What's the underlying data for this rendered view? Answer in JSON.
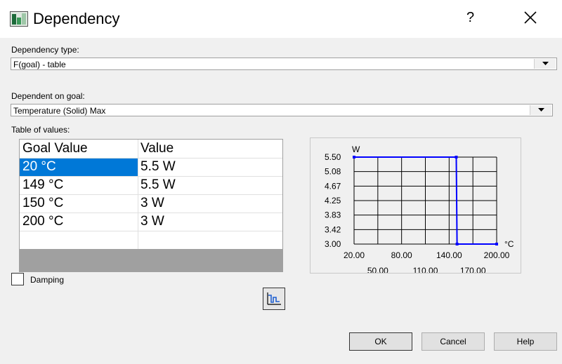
{
  "window": {
    "title": "Dependency",
    "help_label": "?"
  },
  "dependency_type": {
    "label": "Dependency type:",
    "value": "F(goal) - table"
  },
  "dependent_on": {
    "label": "Dependent on goal:",
    "value": "Temperature (Solid) Max"
  },
  "table": {
    "label": "Table of values:",
    "headers": [
      "Goal Value",
      "Value"
    ],
    "rows": [
      [
        "20 °C",
        "5.5 W"
      ],
      [
        "149 °C",
        "5.5 W"
      ],
      [
        "150 °C",
        "3 W"
      ],
      [
        "200 °C",
        "3 W"
      ]
    ],
    "selected_row": 0
  },
  "chart_data": {
    "type": "line",
    "series": [
      {
        "x": [
          20,
          149,
          150,
          200
        ],
        "y": [
          5.5,
          5.5,
          3,
          3
        ]
      }
    ],
    "x_ticks_row1": [
      "20.00",
      "80.00",
      "140.00",
      "200.00"
    ],
    "x_ticks_row2": [
      "50.00",
      "110.00",
      "170.00"
    ],
    "y_ticks": [
      "5.50",
      "5.08",
      "4.67",
      "4.25",
      "3.83",
      "3.42",
      "3.00"
    ],
    "xlabel": "°C",
    "ylabel": "W",
    "xlim": [
      20,
      200
    ],
    "ylim": [
      3,
      5.5
    ],
    "grid": true,
    "line_color": "#0000ff"
  },
  "damping": {
    "label": "Damping",
    "checked": false
  },
  "buttons": {
    "ok": "OK",
    "cancel": "Cancel",
    "help": "Help"
  },
  "icons": {
    "app": "dependency-app-icon",
    "chart_toggle": "chart-icon",
    "close": "close-icon"
  }
}
